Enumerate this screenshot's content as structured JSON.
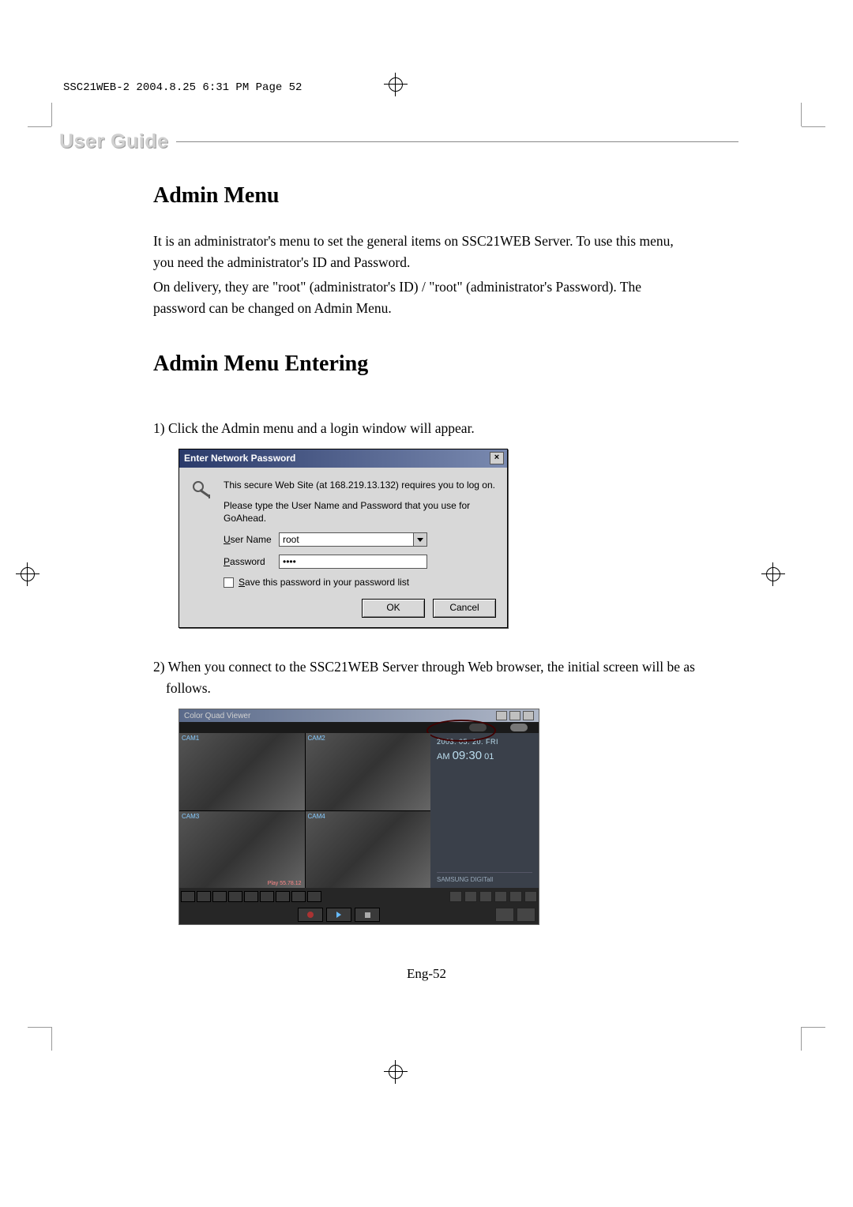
{
  "print_header": "SSC21WEB-2  2004.8.25  6:31 PM  Page 52",
  "section_title": "User Guide",
  "page_number": "Eng-52",
  "admin_menu": {
    "heading": "Admin Menu",
    "p1": "It is an administrator's menu to set the general items on SSC21WEB Server.  To use this menu, you need the administrator's ID and Password.",
    "p2": "On delivery, they are \"root\" (administrator's ID) / \"root\" (administrator's Password).  The password can be changed on Admin Menu."
  },
  "admin_entering": {
    "heading": "Admin Menu Entering",
    "step1": "1) Click the Admin menu and a login window will appear.",
    "step2": "2) When you connect to the SSC21WEB Server through Web browser, the initial screen will be as follows."
  },
  "dialog": {
    "title": "Enter Network Password",
    "close_x": "×",
    "msg1": "This secure Web Site (at 168.219.13.132) requires you to log on.",
    "msg2": "Please type the User Name and Password that you use for GoAhead.",
    "username_label_u": "U",
    "username_label_rest": "ser Name",
    "password_label_u": "P",
    "password_label_rest": "assword",
    "save_label_u": "S",
    "save_label_rest": "ave this password in your password list",
    "username_value": "root",
    "password_value": "••••",
    "ok": "OK",
    "cancel": "Cancel"
  },
  "viewer": {
    "title": "Color Quad Viewer",
    "date": "2003. 05. 20. FRI",
    "time_prefix": "AM ",
    "time_main": "09:30",
    "time_sec": " 01",
    "brand": "SAMSUNG DIGITall",
    "cam1": "CAM1",
    "cam2": "CAM2",
    "cam3": "CAM3",
    "cam4": "CAM4",
    "play_label": "Play 55.78.12"
  }
}
